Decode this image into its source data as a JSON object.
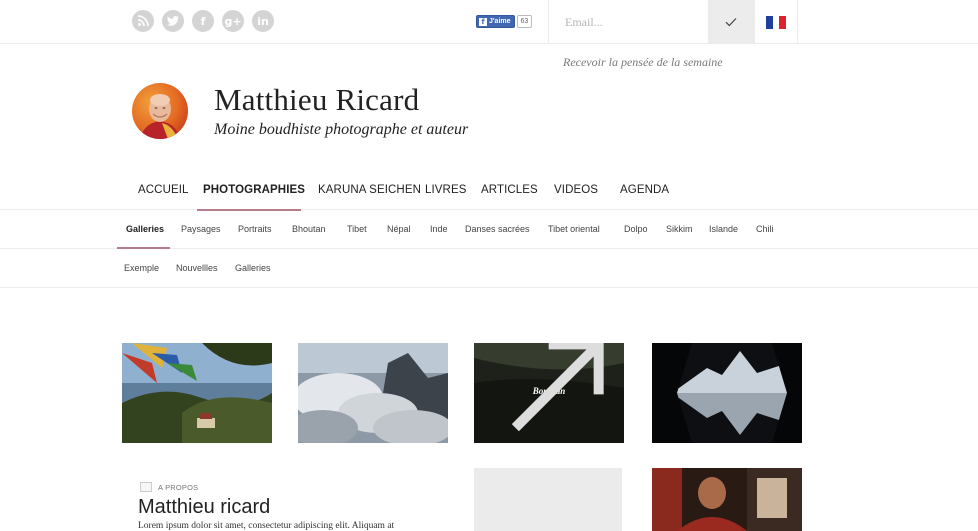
{
  "topbar": {
    "social": [
      {
        "name": "rss-icon",
        "glyph": "rss"
      },
      {
        "name": "twitter-icon",
        "glyph": "twitter"
      },
      {
        "name": "facebook-icon",
        "glyph": "f"
      },
      {
        "name": "google-plus-icon",
        "glyph": "g+"
      },
      {
        "name": "linkedin-icon",
        "glyph": "in"
      }
    ],
    "facebook_like": {
      "label": "J'aime",
      "count": "63"
    },
    "email": {
      "placeholder": "Email..."
    },
    "submit_icon": "check-icon",
    "language": {
      "flag_colors": [
        "#1f3f9a",
        "#ffffff",
        "#e0202d"
      ]
    }
  },
  "newsletter_note": "Recevoir la pensée de la semaine",
  "brand": {
    "title": "Matthieu Ricard",
    "subtitle": "Moine boudhiste photographe et auteur"
  },
  "main_nav": {
    "items": [
      {
        "label": "ACCUEIL"
      },
      {
        "label": "PHOTOGRAPHIES"
      },
      {
        "label": "KARUNA SEICHEN"
      },
      {
        "label": "LIVRES"
      },
      {
        "label": "ARTICLES"
      },
      {
        "label": "VIDEOS"
      },
      {
        "label": "AGENDA"
      }
    ],
    "active": "PHOTOGRAPHIES"
  },
  "sub_nav": {
    "items": [
      {
        "label": "Galleries"
      },
      {
        "label": "Paysages"
      },
      {
        "label": "Portraits"
      },
      {
        "label": "Bhoutan"
      },
      {
        "label": "Tibet"
      },
      {
        "label": "Népal"
      },
      {
        "label": "Inde"
      },
      {
        "label": "Danses sacrées"
      },
      {
        "label": "Tibet oriental"
      },
      {
        "label": "Dolpo"
      },
      {
        "label": "Sikkim"
      },
      {
        "label": "Islande"
      },
      {
        "label": "Chili"
      }
    ],
    "active": "Galleries"
  },
  "third_nav": {
    "items": [
      {
        "label": "Exemple"
      },
      {
        "label": "Nouvellles"
      },
      {
        "label": "Galleries"
      }
    ]
  },
  "gallery": {
    "hover_caption": "Bouthan"
  },
  "about": {
    "kicker": "A PROPOS",
    "title": "Matthieu ricard",
    "text": "Lorem ipsum dolor sit amet, consectetur adipiscing elit. Aliquam at"
  },
  "colors": {
    "accent_underline": "#b67e8a",
    "social_icon_bg": "#d4d4d4",
    "divider": "#ececec"
  }
}
